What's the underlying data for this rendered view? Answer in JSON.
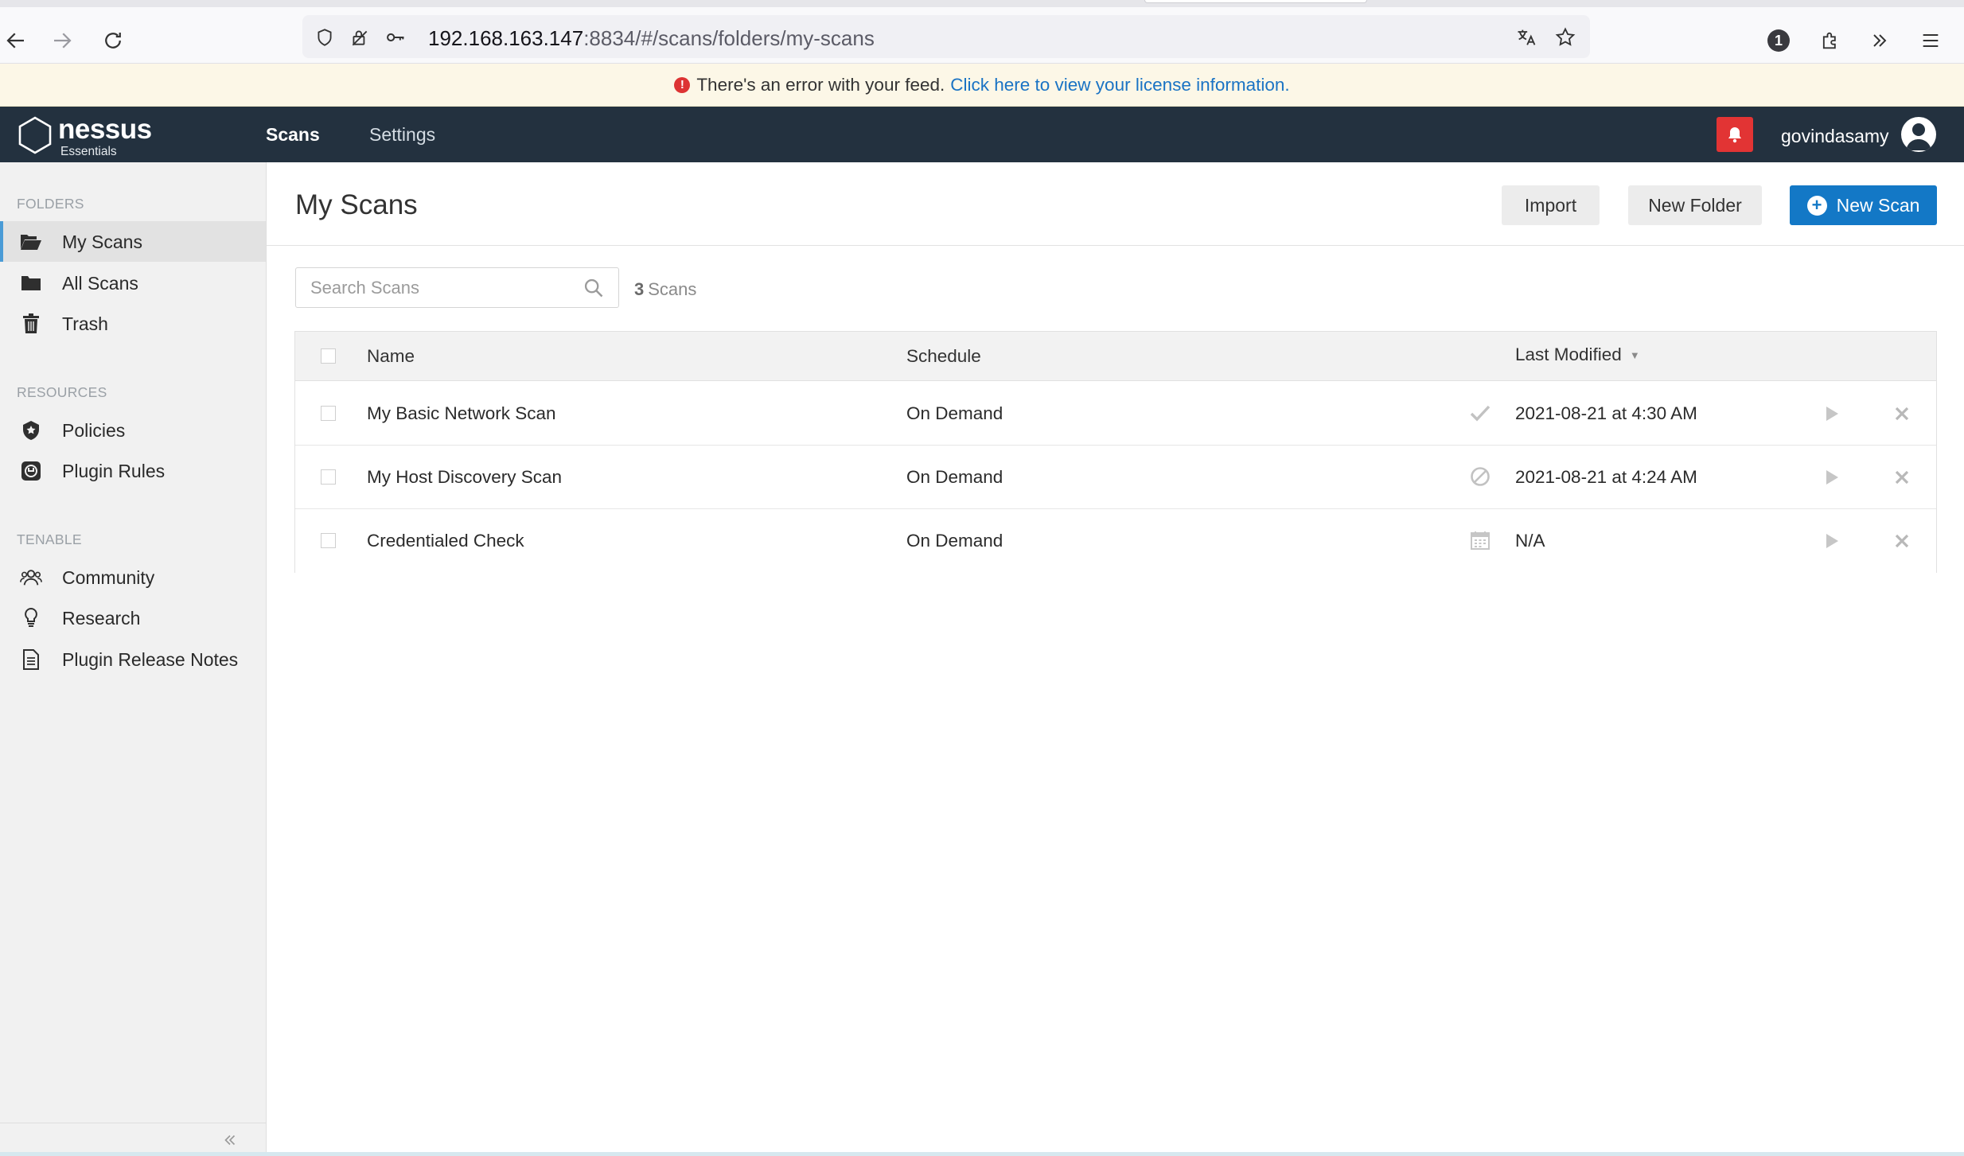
{
  "browser": {
    "url_host": "192.168.163.147",
    "url_rest": ":8834/#/scans/folders/my-scans",
    "notification_count": "1"
  },
  "banner": {
    "message": "There's an error with your feed.",
    "link_text": "Click here to view your license information.",
    "icon": "exclamation-circle-icon"
  },
  "header": {
    "logo_text": "nessus",
    "logo_sub": "Essentials",
    "nav_scans": "Scans",
    "nav_settings": "Settings",
    "username": "govindasamy"
  },
  "sidebar": {
    "folders_heading": "FOLDERS",
    "folders": [
      {
        "label": "My Scans",
        "icon": "folder-open-icon",
        "active": true
      },
      {
        "label": "All Scans",
        "icon": "folder-icon"
      },
      {
        "label": "Trash",
        "icon": "trash-icon"
      }
    ],
    "resources_heading": "RESOURCES",
    "resources": [
      {
        "label": "Policies",
        "icon": "shield-star-icon"
      },
      {
        "label": "Plugin Rules",
        "icon": "plugin-rules-icon"
      }
    ],
    "tenable_heading": "TENABLE",
    "tenable": [
      {
        "label": "Community",
        "icon": "users-icon"
      },
      {
        "label": "Research",
        "icon": "lightbulb-icon"
      },
      {
        "label": "Plugin Release Notes",
        "icon": "document-icon"
      }
    ]
  },
  "main": {
    "title": "My Scans",
    "import_label": "Import",
    "new_folder_label": "New Folder",
    "new_scan_label": "New Scan",
    "search_placeholder": "Search Scans",
    "scan_count": "3",
    "scan_count_label": "Scans"
  },
  "table": {
    "headers": {
      "name": "Name",
      "schedule": "Schedule",
      "last_modified": "Last Modified"
    },
    "rows": [
      {
        "name": "My Basic Network Scan",
        "schedule": "On Demand",
        "status_icon": "check-icon",
        "last_modified": "2021-08-21 at 4:30 AM"
      },
      {
        "name": "My Host Discovery Scan",
        "schedule": "On Demand",
        "status_icon": "canceled-icon",
        "last_modified": "2021-08-21 at 4:24 AM"
      },
      {
        "name": "Credentialed Check",
        "schedule": "On Demand",
        "status_icon": "calendar-icon",
        "last_modified": "N/A"
      }
    ]
  },
  "colors": {
    "header_bg": "#23313f",
    "primary": "#1378c6",
    "alert": "#e23434",
    "banner_bg": "#fcf7e7",
    "link": "#1a73c4"
  }
}
